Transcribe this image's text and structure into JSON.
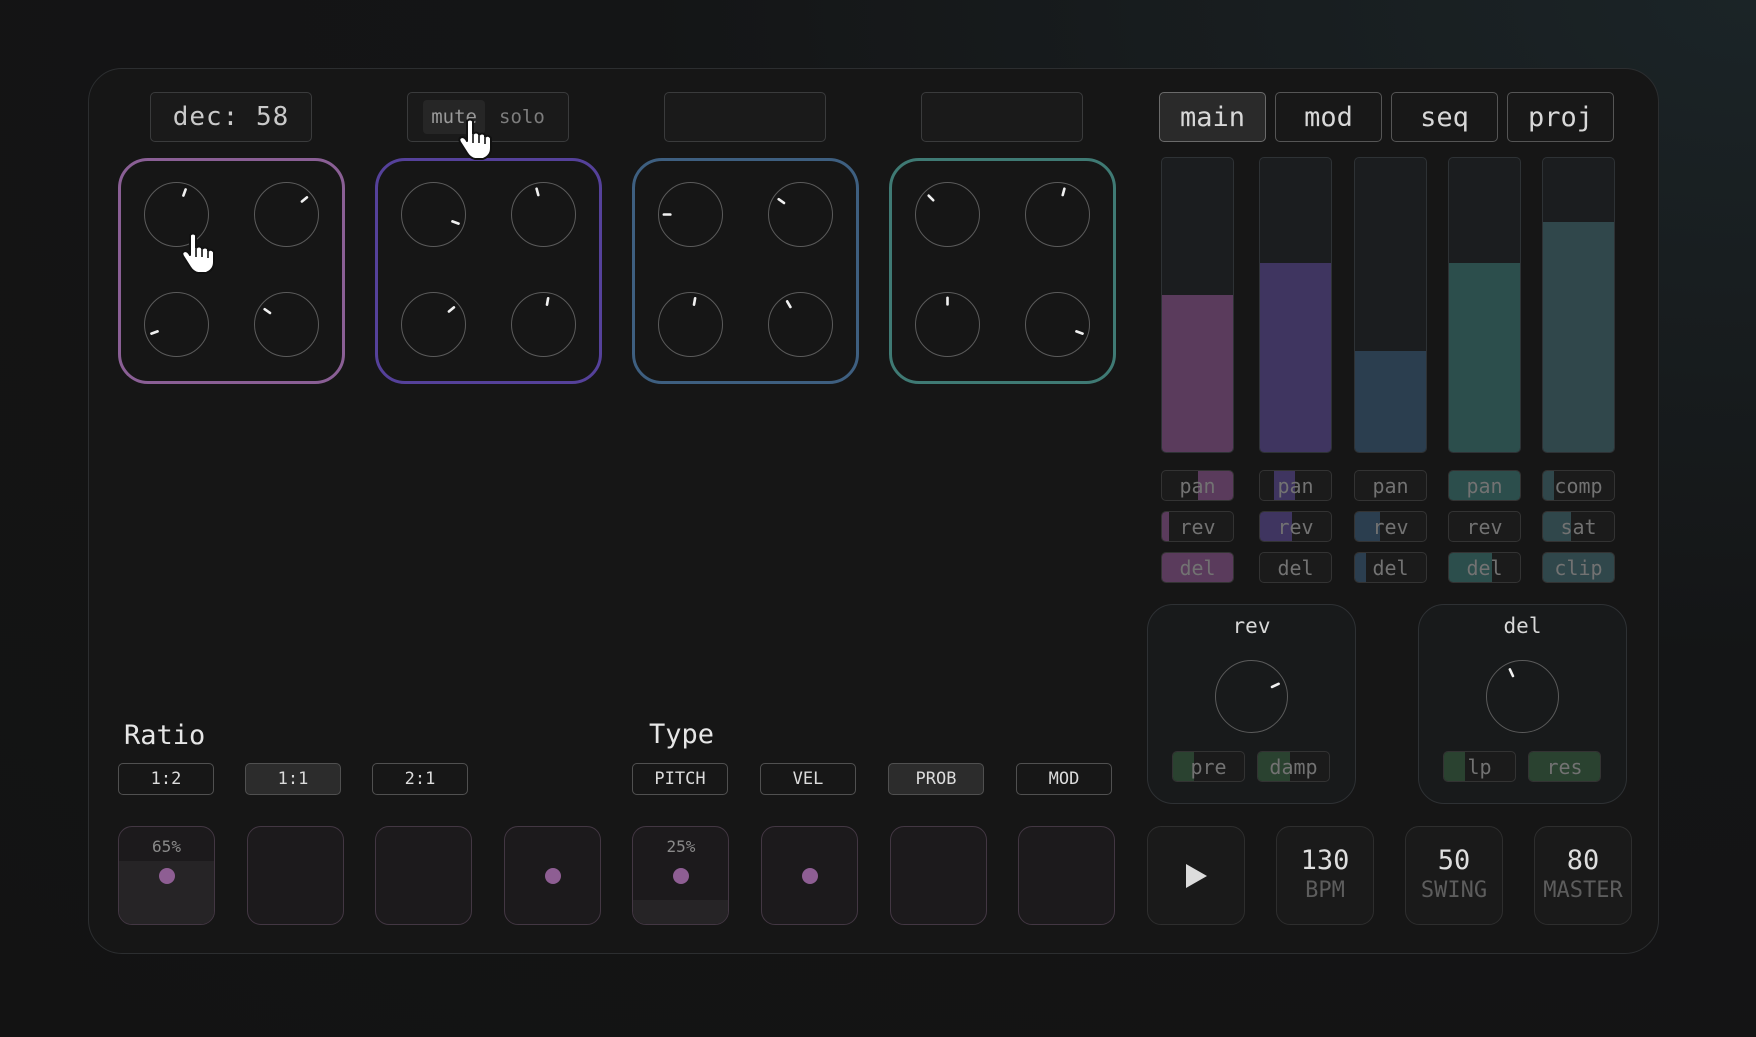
{
  "display": {
    "readout": "dec: 58",
    "mute_label": "mute",
    "solo_label": "solo",
    "active_mode": "mute"
  },
  "tabs": [
    {
      "label": "main",
      "active": true
    },
    {
      "label": "mod",
      "active": false
    },
    {
      "label": "seq",
      "active": false
    },
    {
      "label": "proj",
      "active": false
    }
  ],
  "knob_groups": [
    {
      "color": "#8a5f95",
      "knob_angles": [
        20,
        50,
        -110,
        -55
      ]
    },
    {
      "color": "#55419a",
      "knob_angles": [
        110,
        -15,
        50,
        10
      ]
    },
    {
      "color": "#3e5f80",
      "knob_angles": [
        -90,
        -55,
        10,
        -30
      ]
    },
    {
      "color": "#3f7a74",
      "knob_angles": [
        -45,
        15,
        0,
        110
      ]
    }
  ],
  "mixer": {
    "channels": [
      {
        "color": "#5a3b5c",
        "level": 0.53,
        "sends": [
          {
            "label": "pan",
            "amount": 0.5,
            "offset": 0.5
          },
          {
            "label": "rev",
            "amount": 0.1,
            "offset": 0
          },
          {
            "label": "del",
            "amount": 1.0,
            "offset": 0
          }
        ]
      },
      {
        "color": "#3f3560",
        "level": 0.64,
        "sends": [
          {
            "label": "pan",
            "amount": 0.3,
            "offset": 0.2
          },
          {
            "label": "rev",
            "amount": 0.45,
            "offset": 0
          },
          {
            "label": "del",
            "amount": 0.0,
            "offset": 0
          }
        ]
      },
      {
        "color": "#2b3e4f",
        "level": 0.34,
        "sends": [
          {
            "label": "pan",
            "amount": 0.0,
            "offset": 0
          },
          {
            "label": "rev",
            "amount": 0.35,
            "offset": 0
          },
          {
            "label": "del",
            "amount": 0.15,
            "offset": 0
          }
        ]
      },
      {
        "color": "#2c4e4c",
        "level": 0.64,
        "sends": [
          {
            "label": "pan",
            "amount": 1.0,
            "offset": 0
          },
          {
            "label": "rev",
            "amount": 0.0,
            "offset": 0
          },
          {
            "label": "del",
            "amount": 0.6,
            "offset": 0
          }
        ]
      },
      {
        "color": "#30474b",
        "level": 0.78,
        "sends": [
          {
            "label": "comp",
            "amount": 0.15,
            "offset": 0
          },
          {
            "label": "sat",
            "amount": 0.4,
            "offset": 0
          },
          {
            "label": "clip",
            "amount": 1.0,
            "offset": 0
          }
        ]
      }
    ]
  },
  "fx": [
    {
      "title": "rev",
      "knob_angle": 65,
      "params": [
        {
          "label": "pre",
          "amount": 0.3
        },
        {
          "label": "damp",
          "amount": 0.45
        }
      ]
    },
    {
      "title": "del",
      "knob_angle": -25,
      "params": [
        {
          "label": "lp",
          "amount": 0.3
        },
        {
          "label": "res",
          "amount": 1.0
        }
      ]
    }
  ],
  "ratio": {
    "label": "Ratio",
    "options": [
      "1:2",
      "1:1",
      "2:1"
    ],
    "selected": "1:1"
  },
  "type": {
    "label": "Type",
    "options": [
      "PITCH",
      "VEL",
      "PROB",
      "MOD"
    ],
    "selected": "PROB"
  },
  "pads": [
    {
      "value_label": "65%",
      "value": 0.65,
      "active": true
    },
    {
      "value_label": "",
      "value": 0,
      "active": false
    },
    {
      "value_label": "",
      "value": 0,
      "active": false
    },
    {
      "value_label": "",
      "value": 0,
      "active": true
    },
    {
      "value_label": "25%",
      "value": 0.25,
      "active": true
    },
    {
      "value_label": "",
      "value": 0,
      "active": true
    },
    {
      "value_label": "",
      "value": 0,
      "active": false
    },
    {
      "value_label": "",
      "value": 0,
      "active": false
    }
  ],
  "transport": {
    "play_icon": "play-icon",
    "bpm": {
      "value": "130",
      "label": "BPM"
    },
    "swing": {
      "value": "50",
      "label": "SWING"
    },
    "master": {
      "value": "80",
      "label": "MASTER"
    }
  },
  "cursor_icon": "hand-pointer-icon"
}
